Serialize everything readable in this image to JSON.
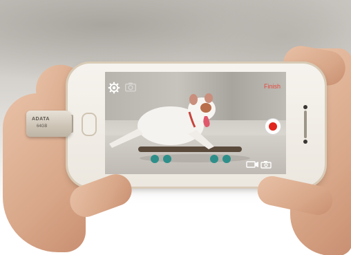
{
  "camera_app": {
    "finish_label": "Finish",
    "icons": {
      "settings": "gear-icon",
      "gallery": "camera-roll-icon",
      "record": "record-icon",
      "mode": "video-photo-toggle-icon"
    },
    "record_color": "#e0261e",
    "finish_color": "#e4483b"
  },
  "usb_drive": {
    "brand": "ADATA",
    "capacity": "64GB"
  }
}
